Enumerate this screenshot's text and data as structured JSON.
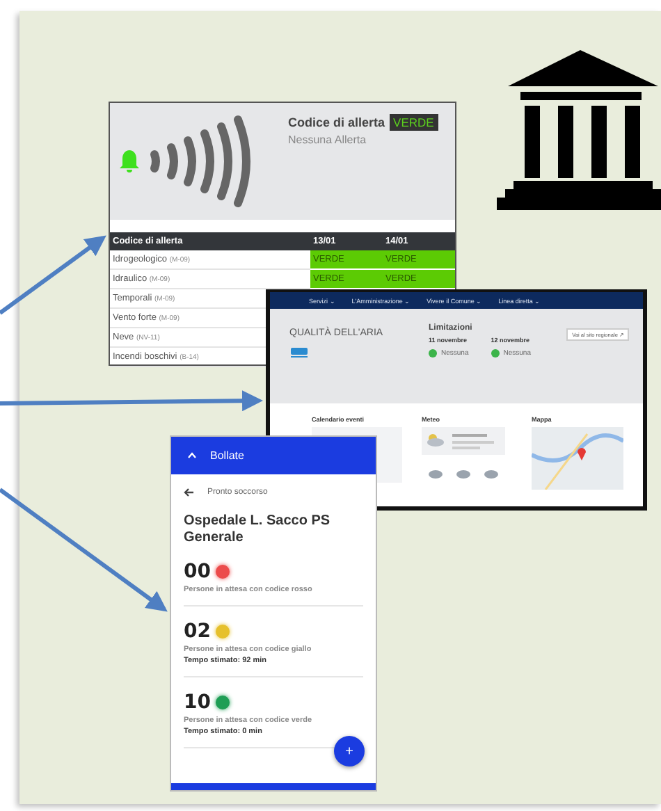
{
  "alert_panel": {
    "title": "Codice di allerta",
    "badge": "VERDE",
    "subtitle": "Nessuna Allerta",
    "table": {
      "columns": [
        "Codice di allerta",
        "13/01",
        "14/01"
      ],
      "rows": [
        {
          "cells": [
            "Idrogeologico",
            "VERDE",
            "VERDE"
          ],
          "code": "(M-09)"
        },
        {
          "cells": [
            "Idraulico",
            "VERDE",
            "VERDE"
          ],
          "code": "(M-09)"
        },
        {
          "cells": [
            "Temporali"
          ],
          "code": "(M-09)"
        },
        {
          "cells": [
            "Vento forte"
          ],
          "code": "(M-09)"
        },
        {
          "cells": [
            "Neve"
          ],
          "code": "(NV-11)"
        },
        {
          "cells": [
            "Incendi boschivi"
          ],
          "code": "(B-14)"
        }
      ]
    }
  },
  "air_quality_page": {
    "nav": [
      "Servizi ⌄",
      "L'Amministrazione ⌄",
      "Vivere il Comune ⌄",
      "Linea diretta ⌄"
    ],
    "title": "QUALITÀ DELL'ARIA",
    "limits_title": "Limitazioni",
    "days": [
      {
        "date": "11 novembre",
        "status": "Nessuna",
        "color": "#3cb44a"
      },
      {
        "date": "12 novembre",
        "status": "Nessuna",
        "color": "#3cb44a"
      }
    ],
    "link_button": "Vai al sito regionale ↗",
    "sections": [
      "Calendario eventi",
      "Meteo",
      "Mappa"
    ]
  },
  "hospital_app": {
    "header": "Bollate",
    "back": "Pronto soccorso",
    "hospital": "Ospedale L. Sacco PS Generale",
    "queues": [
      {
        "count": "00",
        "color": "#ec4b4b",
        "label": "Persone in attesa con codice rosso"
      },
      {
        "count": "02",
        "color": "#e6c02c",
        "label": "Persone in attesa con codice giallo",
        "wait": "Tempo stimato: 92 min"
      },
      {
        "count": "10",
        "color": "#1f9e55",
        "label": "Persone in attesa con codice verde",
        "wait": "Tempo stimato: 0 min"
      }
    ],
    "fab": "+"
  }
}
